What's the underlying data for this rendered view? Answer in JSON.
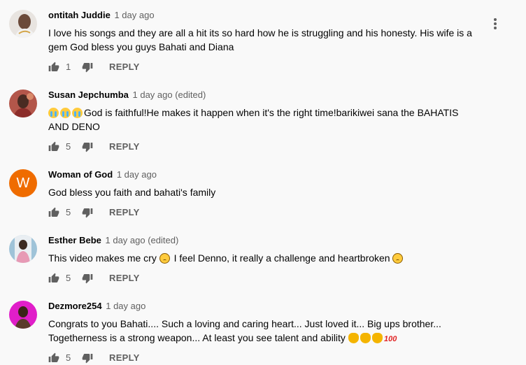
{
  "comments": [
    {
      "author": "ontitah Juddie",
      "time": "1 day ago",
      "text_lines": [
        "I love his songs and they are all a hit its so hard how he is struggling and his honesty. His wife is a",
        "gem God bless you guys Bahati and Diana"
      ],
      "likes": "1",
      "reply_label": "REPLY",
      "avatar": "photo"
    },
    {
      "author": "Susan Jepchumba",
      "time": "1 day ago (edited)",
      "text_line1": "God is faithful!He makes it happen when it's the right time!barikiwei sana the BAHATIS",
      "text_line2": "AND DENO",
      "likes": "5",
      "reply_label": "REPLY",
      "avatar": "photo"
    },
    {
      "author": "Woman of God",
      "time": "1 day ago",
      "text": "God bless you faith and bahati's family",
      "likes": "5",
      "reply_label": "REPLY",
      "avatar_letter": "W",
      "avatar_color": "#ef6c00"
    },
    {
      "author": "Esther Bebe",
      "time": "1 day ago (edited)",
      "text_part1": "This video makes me cry",
      "text_part2": "I feel Denno, it really a challenge and heartbroken",
      "likes": "5",
      "reply_label": "REPLY",
      "avatar": "photo"
    },
    {
      "author": "Dezmore254",
      "time": "1 day ago",
      "text_line1": "Congrats to you Bahati.... Such a loving and caring heart... Just loved it... Big ups brother...",
      "text_line2": "Togetherness is a strong weapon... At least you see talent and ability",
      "emoji_100": "100",
      "likes": "5",
      "reply_label": "REPLY",
      "avatar": "photo"
    }
  ],
  "icons": {
    "like": "thumb-up-icon",
    "dislike": "thumb-down-icon",
    "menu": "more-vert-icon",
    "emoji_cry": "loudly-crying-face-icon",
    "emoji_sad": "sad-face-icon",
    "emoji_hands": "open-hands-icon",
    "emoji_100": "hundred-points-icon"
  },
  "colors": {
    "background": "#f9f9f9",
    "text": "#030303",
    "secondary": "#606060",
    "letter_avatar": "#ef6c00"
  }
}
